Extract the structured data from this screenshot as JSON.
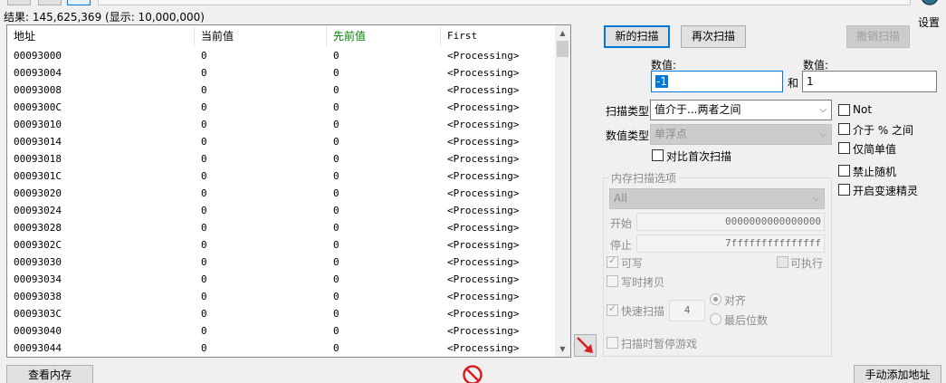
{
  "results": {
    "label": "结果: 145,625,369 (显示: 10,000,000)"
  },
  "settings": {
    "label": "设置",
    "icon": "settings-icon"
  },
  "table": {
    "columns": [
      "地址",
      "当前值",
      "先前值",
      "First"
    ],
    "rows": [
      [
        "00093000",
        "0",
        "0",
        "<Processing>"
      ],
      [
        "00093004",
        "0",
        "0",
        "<Processing>"
      ],
      [
        "00093008",
        "0",
        "0",
        "<Processing>"
      ],
      [
        "0009300C",
        "0",
        "0",
        "<Processing>"
      ],
      [
        "00093010",
        "0",
        "0",
        "<Processing>"
      ],
      [
        "00093014",
        "0",
        "0",
        "<Processing>"
      ],
      [
        "00093018",
        "0",
        "0",
        "<Processing>"
      ],
      [
        "0009301C",
        "0",
        "0",
        "<Processing>"
      ],
      [
        "00093020",
        "0",
        "0",
        "<Processing>"
      ],
      [
        "00093024",
        "0",
        "0",
        "<Processing>"
      ],
      [
        "00093028",
        "0",
        "0",
        "<Processing>"
      ],
      [
        "0009302C",
        "0",
        "0",
        "<Processing>"
      ],
      [
        "00093030",
        "0",
        "0",
        "<Processing>"
      ],
      [
        "00093034",
        "0",
        "0",
        "<Processing>"
      ],
      [
        "00093038",
        "0",
        "0",
        "<Processing>"
      ],
      [
        "0009303C",
        "0",
        "0",
        "<Processing>"
      ],
      [
        "00093040",
        "0",
        "0",
        "<Processing>"
      ],
      [
        "00093044",
        "0",
        "0",
        "<Processing>"
      ]
    ]
  },
  "scan": {
    "new_scan": "新的扫描",
    "next_scan": "再次扫描",
    "undo_scan": "撤销扫描",
    "value_label_1": "数值:",
    "value_label_2": "数值:",
    "value_1": "-1",
    "and_label": "和",
    "value_2": "1",
    "scan_type_label": "扫描类型",
    "scan_type_value": "值介于...两者之间",
    "value_type_label": "数值类型",
    "value_type_value": "单浮点",
    "compare_first": "对比首次扫描",
    "not_label": "Not",
    "percent_label": "介于 % 之间",
    "simple_values": "仅简单值",
    "disable_random": "禁止随机",
    "speedhack": "开启变速精灵"
  },
  "memory_options": {
    "title": "内存扫描选项",
    "region": "All",
    "start_label": "开始",
    "start_value": "0000000000000000",
    "stop_label": "停止",
    "stop_value": "7fffffffffffffff",
    "writable": "可写",
    "executable": "可执行",
    "copy_on_write": "写时拷贝",
    "fast_scan": "快速扫描",
    "fast_scan_value": "4",
    "alignment": "对齐",
    "last_digits": "最后位数",
    "pause_game": "扫描时暂停游戏"
  },
  "bottom": {
    "memory_view": "查看内存",
    "add_address": "手动添加地址"
  },
  "colors": {
    "accent": "#0078d7",
    "previous_value_header": "#008000",
    "arrow": "#d42020"
  }
}
